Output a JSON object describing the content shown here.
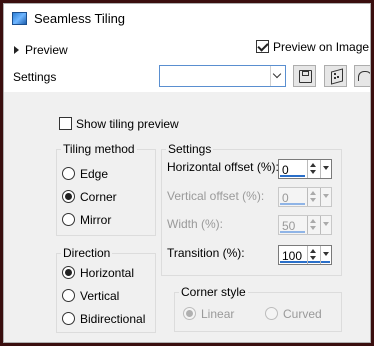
{
  "window": {
    "title": "Seamless Tiling",
    "app_icon": "tiling-app-icon"
  },
  "topbar": {
    "preview_label": "Preview",
    "preview_on_image_label": "Preview on Image",
    "preview_on_image_checked": true,
    "settings_label": "Settings",
    "preset_value": "",
    "icons": {
      "save": "save-preset-icon",
      "random": "dice-icon",
      "reset": "reset-icon"
    }
  },
  "main": {
    "show_tiling_preview_label": "Show tiling preview",
    "show_tiling_preview_checked": false,
    "tiling_method": {
      "legend": "Tiling method",
      "options": [
        "Edge",
        "Corner",
        "Mirror"
      ],
      "selected": "Corner"
    },
    "settings": {
      "legend": "Settings",
      "horizontal_offset": {
        "label": "Horizontal offset (%):",
        "value": "0"
      },
      "vertical_offset": {
        "label": "Vertical offset (%):",
        "value": "0"
      },
      "width": {
        "label": "Width (%):",
        "value": "50"
      },
      "transition": {
        "label": "Transition (%):",
        "value": "100"
      }
    },
    "direction": {
      "legend": "Direction",
      "options": [
        "Horizontal",
        "Vertical",
        "Bidirectional"
      ],
      "selected": "Horizontal"
    },
    "corner_style": {
      "legend": "Corner style",
      "options": [
        "Linear",
        "Curved"
      ],
      "selected": "Linear"
    }
  }
}
